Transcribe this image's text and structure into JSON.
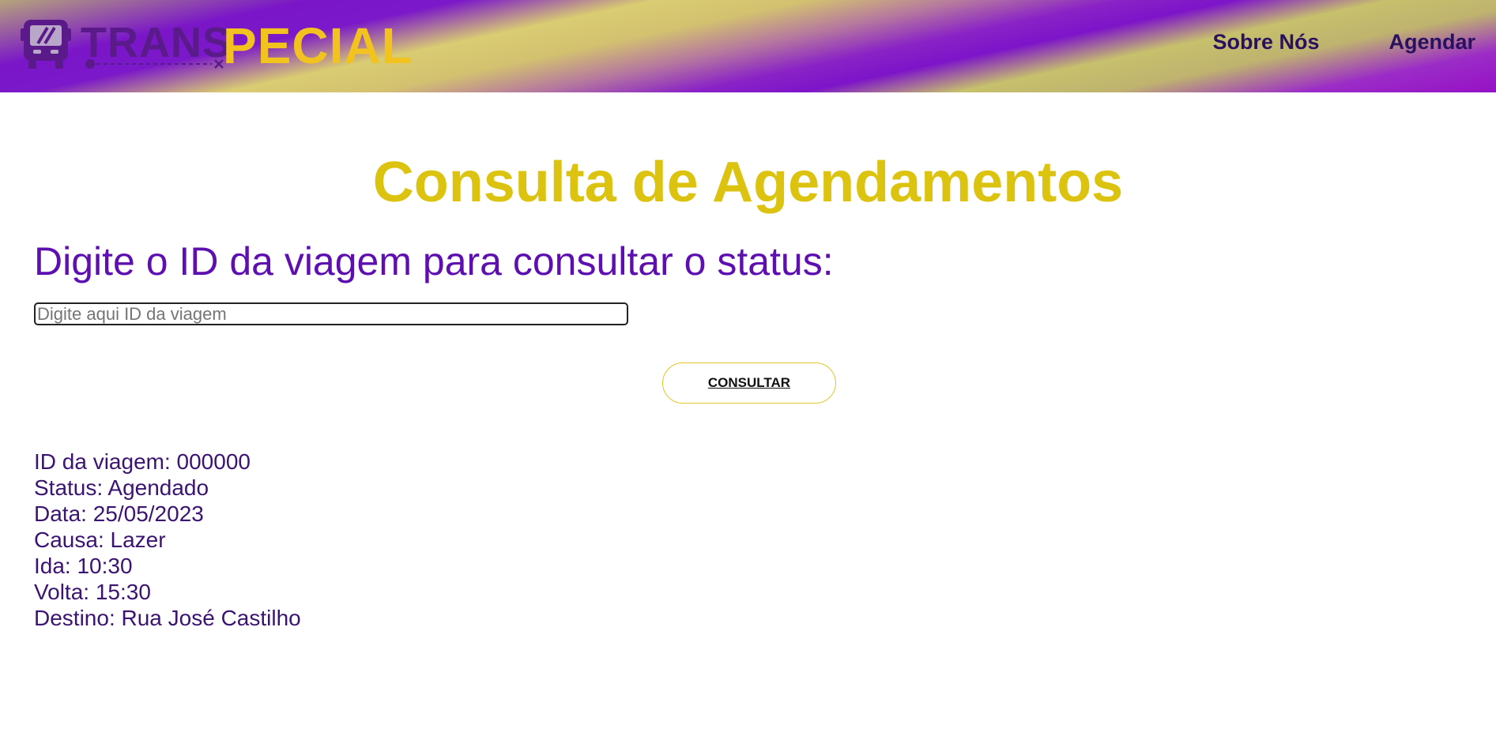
{
  "header": {
    "logo": {
      "word_trans": "TRANS",
      "word_pecial": "PECIAL"
    },
    "nav": [
      {
        "label": "Sobre Nós"
      },
      {
        "label": "Agendar"
      }
    ]
  },
  "main": {
    "title": "Consulta de Agendamentos",
    "subtitle": "Digite o ID da viagem para consultar o status:",
    "search": {
      "placeholder": "Digite aqui ID da viagem",
      "value": ""
    },
    "button_label": "CONSULTAR",
    "result": {
      "id": "ID da viagem: 000000",
      "status": "Status: Agendado",
      "date": "Data: 25/05/2023",
      "cause": "Causa: Lazer",
      "outbound": "Ida: 10:30",
      "return": "Volta: 15:30",
      "destination": "Destino: Rua José Castilho"
    }
  },
  "colors": {
    "brand_purple": "#5e0fb0",
    "brand_yellow": "#dcc310",
    "logo_yellow": "#f2c21e",
    "logo_purple": "#5a1a8a",
    "nav_text": "#2a1160"
  },
  "icons": {
    "logo_icon": "bus-icon",
    "logo_accent": "wheelchair-icon"
  }
}
